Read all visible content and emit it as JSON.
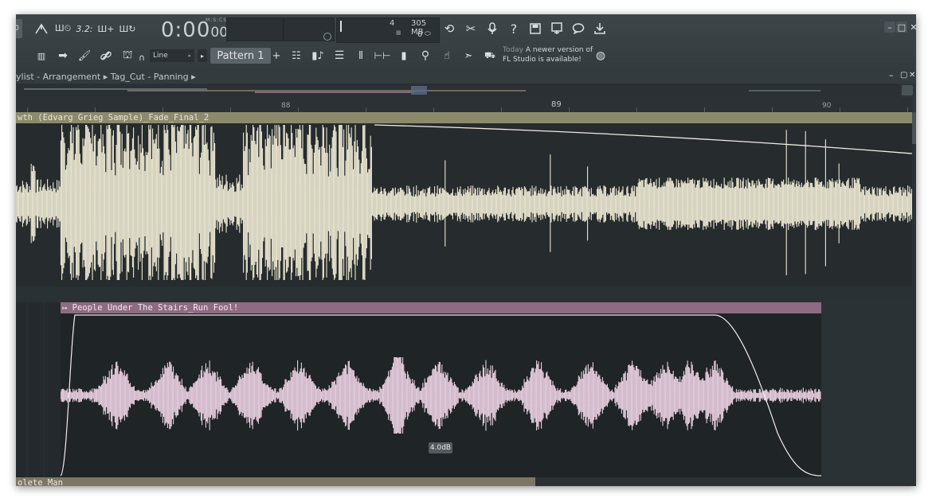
{
  "toolbar": {
    "time_main": "0:00",
    "time_sub": "00",
    "time_format": "M:S:CS",
    "cpu_value": "4",
    "memory": "305 MB",
    "polyphony": "0",
    "pattern_label": "Pattern 1",
    "pattern_add": "+",
    "snap_mode": "Line",
    "ts_label": "3.2:",
    "notice_day": "Today",
    "notice_text_1": "A newer version of",
    "notice_text_2": "FL Studio is available!"
  },
  "playlist": {
    "breadcrumb": "ylist - Arrangement ▸ Tag_Cut - Panning ▸",
    "ruler": [
      "88",
      "89",
      "90"
    ]
  },
  "clips": [
    {
      "name": "wth (Edvarg Grieg Sample)_Fade_Final_2",
      "color": "#8c8a6d",
      "wave_color": "#ebe7d2"
    },
    {
      "name": "↦ People Under The Stairs_Run Fool!",
      "color": "#8e6b82",
      "wave_color": "#e8cfe0"
    },
    {
      "name": "olete Man",
      "color": "#7c7765"
    }
  ],
  "volume_tooltip": "4.0dB",
  "colors": {
    "window_bg": "#2f3538",
    "track_bg": "#23292c",
    "accent": "#ebe7d2"
  },
  "icons": {
    "help": "?",
    "close": "✕",
    "minimize": "–",
    "maximize": "□"
  }
}
